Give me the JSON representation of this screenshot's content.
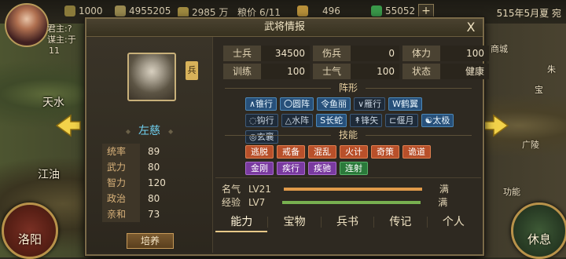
{
  "resources": [
    {
      "name": "wood-icon",
      "value": "1000",
      "color": "#8a7a3a"
    },
    {
      "name": "grain-icon",
      "value": "4955205",
      "color": "#9a8a50"
    },
    {
      "name": "money-icon",
      "value": "2985 万",
      "color": "#a08a40"
    },
    {
      "name": "food-icon",
      "label": "粮价",
      "value": "6/11",
      "color": "#7a6a40"
    },
    {
      "name": "gold-icon",
      "value": "496",
      "color": "#b8903a"
    },
    {
      "name": "gem-icon",
      "value": "55052",
      "color": "#3a9a4a"
    }
  ],
  "date": "515年5月夏 宛",
  "lord": {
    "line1": "君主:?",
    "line2": "谋主:于",
    "level": "11"
  },
  "map": {
    "city1": "天水",
    "city2": "江油",
    "right1": "商城",
    "right2": "宝",
    "right3": "功能",
    "right4": "广陵",
    "right5": "朱"
  },
  "buttons": {
    "left": "洛阳",
    "right": "休息"
  },
  "panel": {
    "title": "武将情报",
    "close": "X",
    "type_badge": "兵",
    "name": "左慈",
    "attributes": [
      {
        "label": "统率",
        "value": "89"
      },
      {
        "label": "武力",
        "value": "80"
      },
      {
        "label": "智力",
        "value": "120"
      },
      {
        "label": "政治",
        "value": "80"
      },
      {
        "label": "亲和",
        "value": "73"
      }
    ],
    "train_button": "培养",
    "stats": [
      [
        {
          "label": "士兵",
          "value": "34500"
        },
        {
          "label": "伤兵",
          "value": "0"
        },
        {
          "label": "体力",
          "value": "100"
        }
      ],
      [
        {
          "label": "训练",
          "value": "100"
        },
        {
          "label": "士气",
          "value": "100"
        },
        {
          "label": "状态",
          "value": "健康"
        }
      ]
    ],
    "formation_title": "阵形",
    "formations": [
      {
        "label": "∧锥行",
        "on": true
      },
      {
        "label": "〇圆阵",
        "on": true
      },
      {
        "label": "令鱼丽",
        "on": true
      },
      {
        "label": "∨雁行",
        "on": false
      },
      {
        "label": "W鹤翼",
        "on": true
      },
      {
        "label": "◌钩行",
        "on": false
      },
      {
        "label": "△水阵",
        "on": false
      },
      {
        "label": "S长蛇",
        "on": true
      },
      {
        "label": "↟锋矢",
        "on": false
      },
      {
        "label": "⊏偃月",
        "on": false
      },
      {
        "label": "☯太极",
        "on": true
      },
      {
        "label": "◎玄襄",
        "on": false
      }
    ],
    "skill_title": "技能",
    "skills": [
      {
        "label": "逃脱",
        "color": "o"
      },
      {
        "label": "戒备",
        "color": "o"
      },
      {
        "label": "混乱",
        "color": "o"
      },
      {
        "label": "火计",
        "color": "o"
      },
      {
        "label": "奇策",
        "color": "o"
      },
      {
        "label": "诡道",
        "color": "o"
      },
      {
        "label": "金刚",
        "color": "p"
      },
      {
        "label": "疾行",
        "color": "p"
      },
      {
        "label": "疾驰",
        "color": "p"
      },
      {
        "label": "连射",
        "color": "g"
      }
    ],
    "fame": {
      "label": "名气",
      "level": "LV21",
      "max": "满",
      "progress": 1.0
    },
    "exp": {
      "label": "经验",
      "level": "LV7",
      "max": "满",
      "progress": 1.0
    },
    "tabs": [
      "能力",
      "宝物",
      "兵书",
      "传记",
      "个人"
    ],
    "active_tab": 0
  }
}
